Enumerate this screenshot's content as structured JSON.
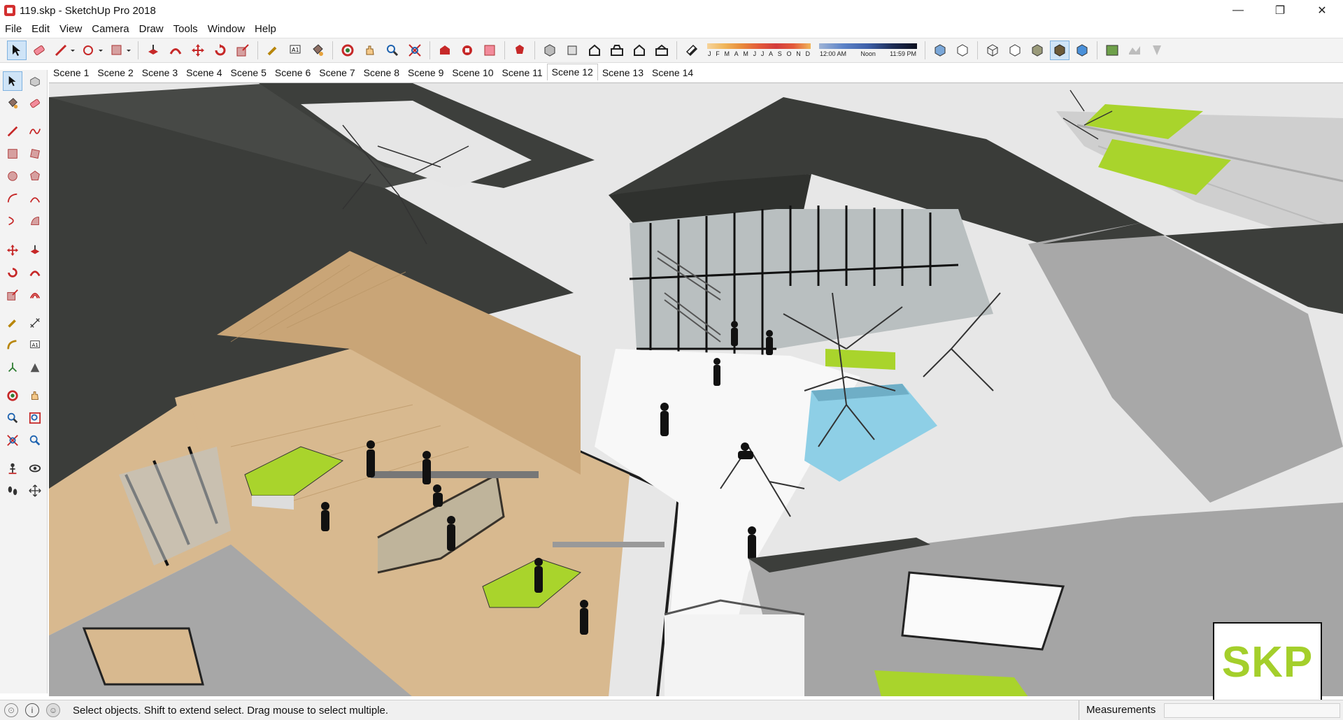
{
  "window": {
    "title": "119.skp - SketchUp Pro 2018",
    "controls": [
      "—",
      "❐",
      "✕"
    ]
  },
  "menu": [
    "File",
    "Edit",
    "View",
    "Camera",
    "Draw",
    "Tools",
    "Window",
    "Help"
  ],
  "shadow_settings": {
    "month_labels": [
      "J",
      "F",
      "M",
      "A",
      "M",
      "J",
      "J",
      "A",
      "S",
      "O",
      "N",
      "D"
    ],
    "time_labels": [
      "12:00 AM",
      "Noon",
      "11:59 PM"
    ]
  },
  "scenes": {
    "tabs": [
      "Scene 1",
      "Scene 2",
      "Scene 3",
      "Scene 4",
      "Scene 5",
      "Scene 6",
      "Scene 7",
      "Scene 8",
      "Scene 9",
      "Scene 10",
      "Scene 11",
      "Scene 12",
      "Scene 13",
      "Scene 14"
    ],
    "active": "Scene 12"
  },
  "status": {
    "message": "Select objects. Shift to extend select. Drag mouse to select multiple.",
    "measurements_label": "Measurements",
    "measurements_value": ""
  },
  "watermark": {
    "text": "SKP"
  },
  "colors": {
    "roof": "#3b3d3a",
    "wood": "#d8b98f",
    "lawn": "#9acd32",
    "pool": "#8ecfe6",
    "select_highlight": "#cfe4f7"
  }
}
